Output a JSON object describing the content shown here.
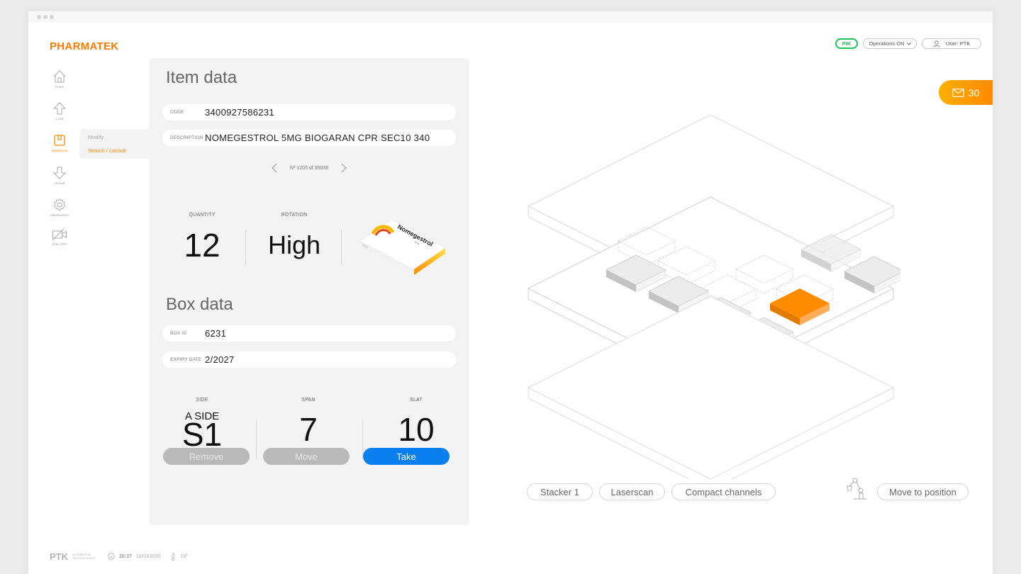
{
  "window": {
    "controls": [
      "close",
      "minimize",
      "maximize"
    ]
  },
  "brand": {
    "name": "PHARMATEK",
    "color": "#ff7a00"
  },
  "header": {
    "mode_badge": "PIK",
    "mode_badge_color": "#1fc15b",
    "operations_label": "Operations ON",
    "user_label": "User: PTK",
    "messages_count": "30",
    "messages_color": "#ff9a00"
  },
  "sidebar": {
    "items": [
      {
        "label": "Home",
        "icon": "home-icon",
        "active": false
      },
      {
        "label": "Load",
        "icon": "arrow-up-icon",
        "active": false
      },
      {
        "label": "Warehouse",
        "icon": "box-icon",
        "active": true
      },
      {
        "label": "Unload",
        "icon": "arrow-down-icon",
        "active": false
      },
      {
        "label": "Maintenance",
        "icon": "gear-icon",
        "active": false
      },
      {
        "label": "Video OFF",
        "icon": "video-off-icon",
        "active": false
      }
    ],
    "submenu": [
      {
        "label": "Modify",
        "active": false
      },
      {
        "label": "Search / consult",
        "active": true
      }
    ],
    "accent": "#ff8a00"
  },
  "item_data": {
    "title": "Item data",
    "code_label": "CODE",
    "code": "3400927586231",
    "description_label": "DESCRIPTION",
    "description": "NOMEGESTROL 5MG BIOGARAN CPR SEC10 340",
    "pager": "Nº 1205 of 35038",
    "quantity_label": "QUANTITY",
    "quantity": "12",
    "rotation_label": "ROTATION",
    "rotation": "High",
    "product_image": {
      "brand": "Nomegestrol",
      "sub": "5mg"
    }
  },
  "box_data": {
    "title": "Box data",
    "box_id_label": "BOX ID",
    "box_id": "6231",
    "expiry_label": "EXPIRY DATE",
    "expiry": "2/2027",
    "side_label": "SIDE",
    "side_sub": "A SIDE",
    "side": "S1",
    "span_label": "SPAN",
    "span": "7",
    "slat_label": "SLAT",
    "slat": "10"
  },
  "actions": {
    "remove": "Remove",
    "move": "Move",
    "take": "Take",
    "take_color": "#0a7ff0"
  },
  "view": {
    "buttons": [
      "Stacker 1",
      "Laserscan",
      "Compact channels"
    ],
    "move_to_position": "Move to position",
    "highlight_color": "#ff8c00"
  },
  "footer": {
    "brand": "PTK",
    "brand_sub": "AUTOMATION TECHNOLOGIES",
    "time": "20:37",
    "date": "11/03/2020",
    "temperature": "19°"
  }
}
